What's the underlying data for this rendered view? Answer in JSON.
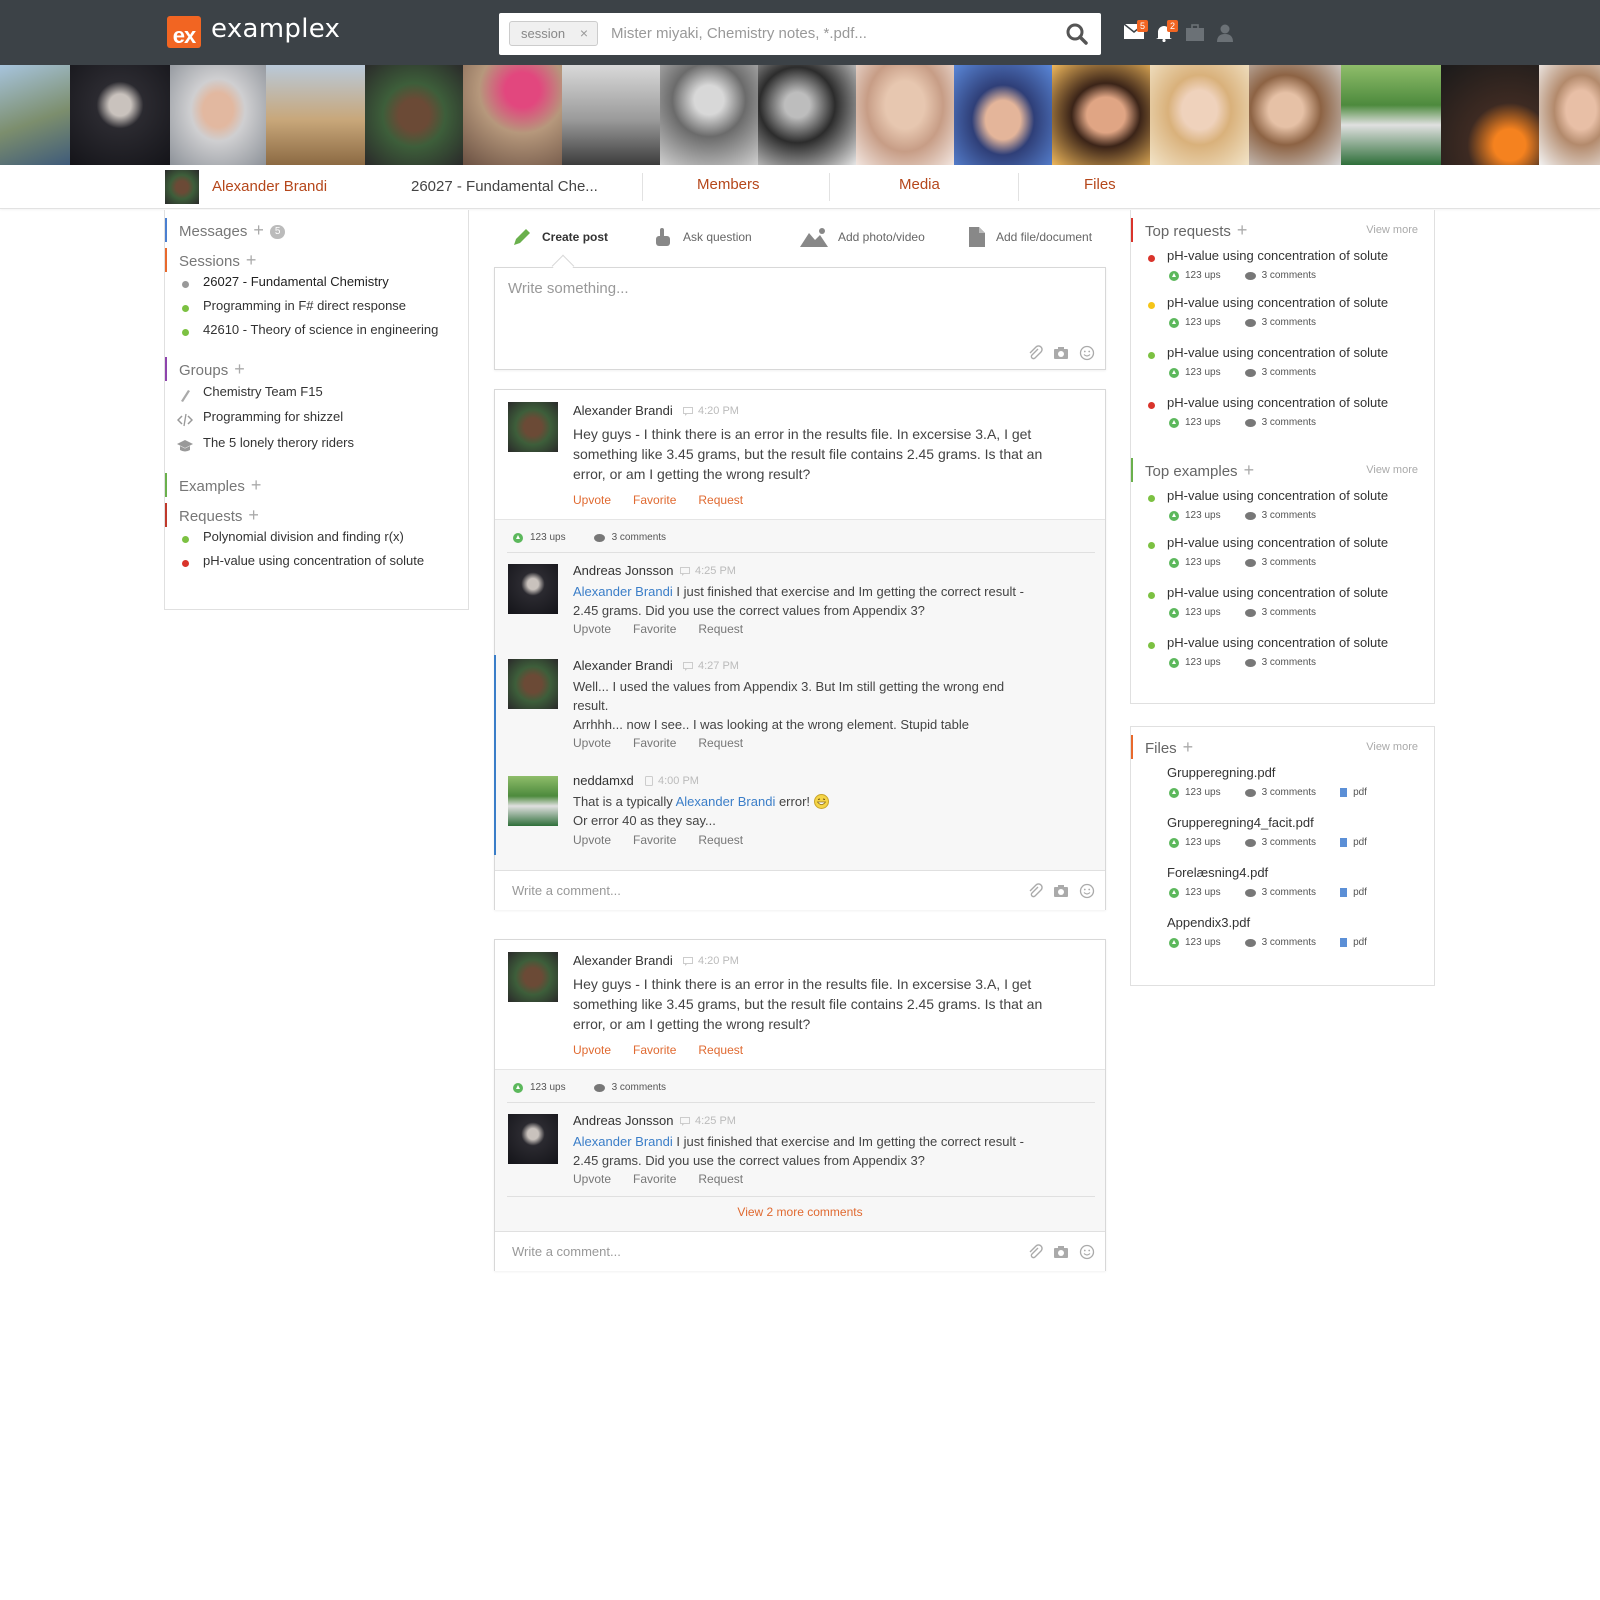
{
  "app": {
    "logo_mark": "ex",
    "name": "examplex",
    "search": {
      "chip": "session",
      "placeholder": "Mister miyaki, Chemistry notes, *.pdf..."
    },
    "icons": [
      {
        "name": "mail-icon",
        "badge": "5"
      },
      {
        "name": "bell-icon",
        "badge": "2"
      },
      {
        "name": "briefcase-icon",
        "badge": ""
      },
      {
        "name": "user-icon",
        "badge": ""
      }
    ]
  },
  "subnav": {
    "user": "Alexander Brandi",
    "course": "26027 - Fundamental Che...",
    "tabs": [
      "Members",
      "Media",
      "Files"
    ]
  },
  "sidebar": {
    "messages": {
      "label": "Messages",
      "count": "5"
    },
    "sessions": {
      "label": "Sessions",
      "items": [
        {
          "label": "26027 - Fundamental Chemistry",
          "status": "grey"
        },
        {
          "label": "Programming in F# direct response",
          "status": "green"
        },
        {
          "label": "42610 - Theory of science in engineering",
          "status": "green"
        }
      ]
    },
    "groups": {
      "label": "Groups",
      "items": [
        {
          "label": "Chemistry Team F15",
          "icon": "flask-icon"
        },
        {
          "label": "Programming for shizzel",
          "icon": "code-icon"
        },
        {
          "label": "The 5 lonely therory riders",
          "icon": "graduation-cap-icon"
        }
      ]
    },
    "examples": {
      "label": "Examples"
    },
    "requests": {
      "label": "Requests",
      "items": [
        {
          "label": "Polynomial division and finding r(x)",
          "status": "green"
        },
        {
          "label": "pH-value using concentration of solute",
          "status": "red"
        }
      ]
    }
  },
  "composer": {
    "tabs": [
      "Create post",
      "Ask question",
      "Add photo/video",
      "Add file/document"
    ],
    "placeholder": "Write something..."
  },
  "posts": [
    {
      "author": "Alexander Brandi",
      "time": "4:20 PM",
      "text": "Hey guys - I think there is an error in the results file. In excersise 3.A, I get something like 3.45 grams, but the result file contains 2.45 grams. Is that an error, or am I getting the wrong result?",
      "actions": [
        "Upvote",
        "Favorite",
        "Request"
      ],
      "ups": "123 ups",
      "comments_count": "3 comments",
      "comments": [
        {
          "author": "Andreas Jonsson",
          "time": "4:25 PM",
          "mention": "Alexander Brandi",
          "text": " I just finished that exercise and Im getting the correct result - 2.45 grams. Did you use the correct values from Appendix 3?"
        },
        {
          "author": "Alexander Brandi",
          "time": "4:27 PM",
          "text": "Well... I used the values from Appendix 3. But Im still getting the wrong end result.",
          "text2": "Arrhhh... now I see.. I was looking at the wrong element. Stupid table"
        },
        {
          "author": "neddamxd",
          "time": "4:00 PM",
          "pre": "That is a typically ",
          "mention": "Alexander Brandi",
          "post": " error!",
          "text2": "Or error 40 as they say..."
        }
      ],
      "comment_placeholder": "Write a comment..."
    },
    {
      "author": "Alexander Brandi",
      "time": "4:20 PM",
      "text": "Hey guys - I think there is an error in the results file. In excersise 3.A, I get something like 3.45 grams, but the result file contains 2.45 grams. Is that an error, or am I getting the wrong result?",
      "actions": [
        "Upvote",
        "Favorite",
        "Request"
      ],
      "ups": "123 ups",
      "comments_count": "3 comments",
      "comments": [
        {
          "author": "Andreas Jonsson",
          "time": "4:25 PM",
          "mention": "Alexander Brandi",
          "text": " I just finished that exercise and Im getting the correct result - 2.45 grams. Did you use the correct values from Appendix 3?"
        }
      ],
      "view_more": "View 2 more comments",
      "comment_placeholder": "Write a comment..."
    }
  ],
  "right": {
    "view_more": "View more",
    "top_requests": {
      "label": "Top requests",
      "items": [
        {
          "title": "pH-value using concentration of solute",
          "status": "red",
          "ups": "123 ups",
          "comments": "3 comments"
        },
        {
          "title": "pH-value using concentration of solute",
          "status": "yellow",
          "ups": "123 ups",
          "comments": "3 comments"
        },
        {
          "title": "pH-value using concentration of solute",
          "status": "green",
          "ups": "123 ups",
          "comments": "3 comments"
        },
        {
          "title": "pH-value using concentration of solute",
          "status": "red",
          "ups": "123 ups",
          "comments": "3 comments"
        }
      ]
    },
    "top_examples": {
      "label": "Top examples",
      "items": [
        {
          "title": "pH-value using concentration of solute",
          "status": "green",
          "ups": "123 ups",
          "comments": "3 comments"
        },
        {
          "title": "pH-value using concentration of solute",
          "status": "green",
          "ups": "123 ups",
          "comments": "3 comments"
        },
        {
          "title": "pH-value using concentration of solute",
          "status": "green",
          "ups": "123 ups",
          "comments": "3 comments"
        },
        {
          "title": "pH-value using concentration of solute",
          "status": "green",
          "ups": "123 ups",
          "comments": "3 comments"
        }
      ]
    },
    "files": {
      "label": "Files",
      "items": [
        {
          "name": "Grupperegning.pdf",
          "ups": "123 ups",
          "comments": "3 comments",
          "type": "pdf"
        },
        {
          "name": "Grupperegning4_facit.pdf",
          "ups": "123 ups",
          "comments": "3 comments",
          "type": "pdf"
        },
        {
          "name": "Forelæsning4.pdf",
          "ups": "123 ups",
          "comments": "3 comments",
          "type": "pdf"
        },
        {
          "name": "Appendix3.pdf",
          "ups": "123 ups",
          "comments": "3 comments",
          "type": "pdf"
        }
      ]
    }
  },
  "colors": {
    "accent": "#f26522",
    "link": "#b5471b",
    "green": "#7cc142",
    "red": "#d9342b",
    "yellow": "#f5c518",
    "grey": "#999999",
    "blue_section": "#4a7fd0",
    "orange_section": "#e8692c",
    "purple_section": "#8e44ad",
    "green_section": "#6ab04c",
    "red_section": "#c0392b"
  }
}
